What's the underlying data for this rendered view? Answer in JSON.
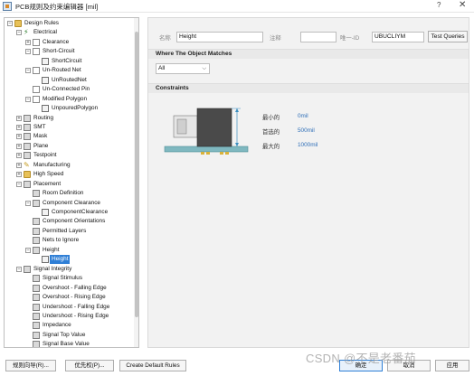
{
  "window": {
    "title": "PCB规则及约束编辑器 [mil]",
    "help": "?",
    "close": "✕"
  },
  "tree": {
    "items": [
      {
        "label": "Design Rules",
        "exp": "−",
        "icon": "folder"
      },
      {
        "label": "Electrical",
        "exp": "−",
        "icon": "elec"
      },
      {
        "label": "Clearance",
        "exp": "+",
        "icon": "rule"
      },
      {
        "label": "Short-Circuit",
        "exp": "−",
        "icon": "rule"
      },
      {
        "label": "ShortCircuit",
        "exp": "",
        "icon": "rule-inst"
      },
      {
        "label": "Un-Routed Net",
        "exp": "−",
        "icon": "rule"
      },
      {
        "label": "UnRoutedNet",
        "exp": "",
        "icon": "rule-inst"
      },
      {
        "label": "Un-Connected Pin",
        "exp": "",
        "icon": "rule"
      },
      {
        "label": "Modified Polygon",
        "exp": "−",
        "icon": "rule"
      },
      {
        "label": "UnpouredPolygon",
        "exp": "",
        "icon": "rule-inst"
      },
      {
        "label": "Routing",
        "exp": "+",
        "icon": "generic"
      },
      {
        "label": "SMT",
        "exp": "+",
        "icon": "generic"
      },
      {
        "label": "Mask",
        "exp": "+",
        "icon": "generic"
      },
      {
        "label": "Plane",
        "exp": "+",
        "icon": "generic"
      },
      {
        "label": "Testpoint",
        "exp": "+",
        "icon": "generic"
      },
      {
        "label": "Manufacturing",
        "exp": "+",
        "icon": "pen"
      },
      {
        "label": "High Speed",
        "exp": "+",
        "icon": "folder"
      },
      {
        "label": "Placement",
        "exp": "−",
        "icon": "generic"
      },
      {
        "label": "Room Definition",
        "exp": "",
        "icon": "generic"
      },
      {
        "label": "Component Clearance",
        "exp": "−",
        "icon": "generic"
      },
      {
        "label": "ComponentClearance",
        "exp": "",
        "icon": "rule-inst"
      },
      {
        "label": "Component Orientations",
        "exp": "",
        "icon": "generic"
      },
      {
        "label": "Permitted Layers",
        "exp": "",
        "icon": "generic"
      },
      {
        "label": "Nets to Ignore",
        "exp": "",
        "icon": "generic"
      },
      {
        "label": "Height",
        "exp": "−",
        "icon": "generic"
      },
      {
        "label": "Height",
        "exp": "",
        "icon": "rule-inst",
        "selected": true
      },
      {
        "label": "Signal Integrity",
        "exp": "−",
        "icon": "generic"
      },
      {
        "label": "Signal Stimulus",
        "exp": "",
        "icon": "generic"
      },
      {
        "label": "Overshoot - Falling Edge",
        "exp": "",
        "icon": "generic"
      },
      {
        "label": "Overshoot - Rising Edge",
        "exp": "",
        "icon": "generic"
      },
      {
        "label": "Undershoot - Falling Edge",
        "exp": "",
        "icon": "generic"
      },
      {
        "label": "Undershoot - Rising Edge",
        "exp": "",
        "icon": "generic"
      },
      {
        "label": "Impedance",
        "exp": "",
        "icon": "generic"
      },
      {
        "label": "Signal Top Value",
        "exp": "",
        "icon": "generic"
      },
      {
        "label": "Signal Base Value",
        "exp": "",
        "icon": "generic"
      }
    ]
  },
  "rule": {
    "name_label": "名称",
    "name_value": "Height",
    "comment_label": "注释",
    "comment_value": "",
    "uid_label": "唯一-ID",
    "uid_value": "UBUCLIYM",
    "test_queries": "Test Queries"
  },
  "where": {
    "header": "Where The Object Matches",
    "selected": "All",
    "chevron": "⌵"
  },
  "constraints": {
    "header": "Constraints",
    "rows": [
      {
        "label": "最小的",
        "value": "0mil"
      },
      {
        "label": "首选的",
        "value": "500mil"
      },
      {
        "label": "最大的",
        "value": "1000mil"
      }
    ]
  },
  "bottom": {
    "wizard": "规则向导(R)...",
    "priorities": "优先权(P)...",
    "create_default": "Create Default Rules",
    "ok": "确定",
    "cancel": "取消",
    "apply": "应用"
  },
  "watermark": "CSDN @不是老番茄"
}
